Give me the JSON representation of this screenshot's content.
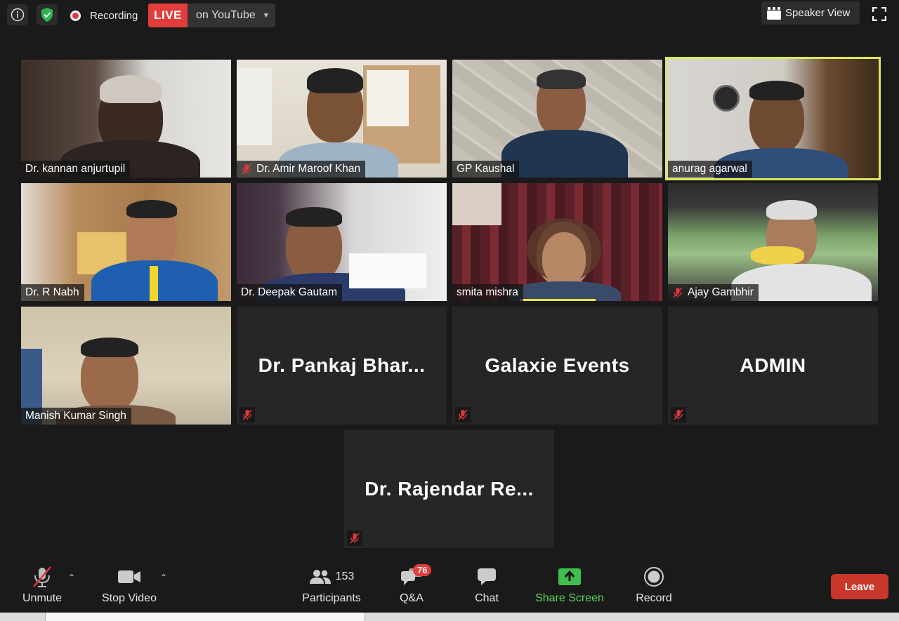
{
  "topbar": {
    "recording_label": "Recording",
    "live_badge": "LIVE",
    "live_destination": "on YouTube",
    "view_button": "Speaker View"
  },
  "participants_grid": [
    {
      "name": "Dr. kannan anjurtupil",
      "muted": false,
      "video": true
    },
    {
      "name": "Dr. Amir Maroof Khan",
      "muted": true,
      "video": true
    },
    {
      "name": "GP Kaushal",
      "muted": false,
      "video": true
    },
    {
      "name": "anurag agarwal",
      "muted": false,
      "video": true,
      "active_speaker": true
    },
    {
      "name": "Dr. R Nabh",
      "muted": false,
      "video": true
    },
    {
      "name": "Dr. Deepak Gautam",
      "muted": false,
      "video": true
    },
    {
      "name": "smita mishra",
      "muted": false,
      "video": true
    },
    {
      "name": "Ajay Gambhir",
      "muted": true,
      "video": true
    },
    {
      "name": "Manish Kumar Singh",
      "muted": false,
      "video": true
    },
    {
      "name": "Dr.  Pankaj  Bhar...",
      "muted": true,
      "video": false
    },
    {
      "name": "Galaxie Events",
      "muted": true,
      "video": false
    },
    {
      "name": "ADMIN",
      "muted": true,
      "video": false
    },
    {
      "name": "Dr.  Rajendar  Re...",
      "muted": true,
      "video": false
    }
  ],
  "toolbar": {
    "unmute": "Unmute",
    "stop_video": "Stop Video",
    "participants": "Participants",
    "participants_count": "153",
    "qa": "Q&A",
    "qa_badge": "76",
    "chat": "Chat",
    "share_screen": "Share Screen",
    "record": "Record",
    "leave": "Leave"
  },
  "colors": {
    "background": "#1a1a1a",
    "tile": "#262626",
    "live_red": "#e23c3c",
    "active_speaker_border": "#dbe95a",
    "share_green": "#5bd35b",
    "leave_red": "#c9372c",
    "muted_red": "#e0373d"
  },
  "icons": {
    "info": "info-icon",
    "security": "shield-check-icon",
    "recording": "recording-dot-icon",
    "speaker_view": "grid-view-icon",
    "fullscreen": "fullscreen-icon",
    "mic_off": "mic-off-icon",
    "video": "video-camera-icon",
    "participants": "people-icon",
    "qa": "speech-bubbles-icon",
    "chat": "chat-bubble-icon",
    "share": "share-screen-arrow-icon",
    "record": "record-icon"
  }
}
